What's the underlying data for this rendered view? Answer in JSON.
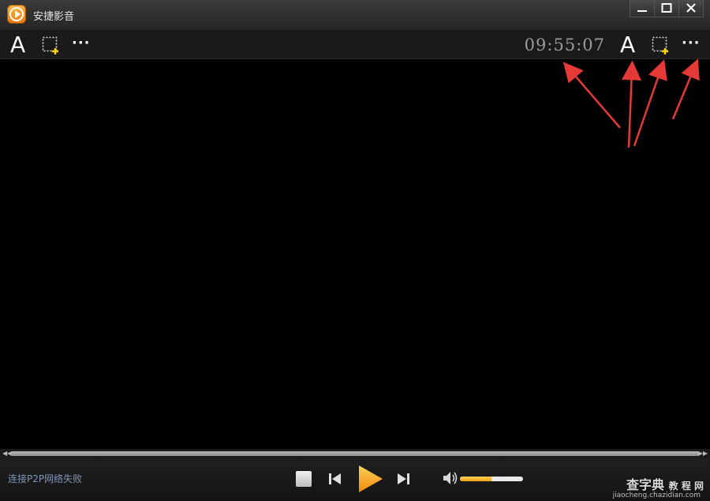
{
  "app": {
    "title": "安捷影音"
  },
  "toolbar": {
    "left_font_glyph": "A",
    "left_more": "···",
    "clock": "09:55:07",
    "right_font_glyph": "A",
    "right_more": "···"
  },
  "status": {
    "text": "连接P2P网络失败"
  },
  "volume": {
    "level": 0.5
  },
  "watermark": {
    "brand": "查字典",
    "sub": "教 程 网",
    "url": "jiaocheng.chazidian.com"
  },
  "colors": {
    "accent": "#f5a623",
    "arrow": "#e53935",
    "status_text": "#7f95b8"
  },
  "icons": {
    "logo": "play-logo-icon",
    "minimize": "minimize-icon",
    "maximize": "maximize-icon",
    "close": "close-icon",
    "screenshot": "screenshot-icon",
    "stop": "stop-icon",
    "prev": "previous-icon",
    "play": "play-icon",
    "next": "next-icon",
    "volume": "volume-icon"
  }
}
